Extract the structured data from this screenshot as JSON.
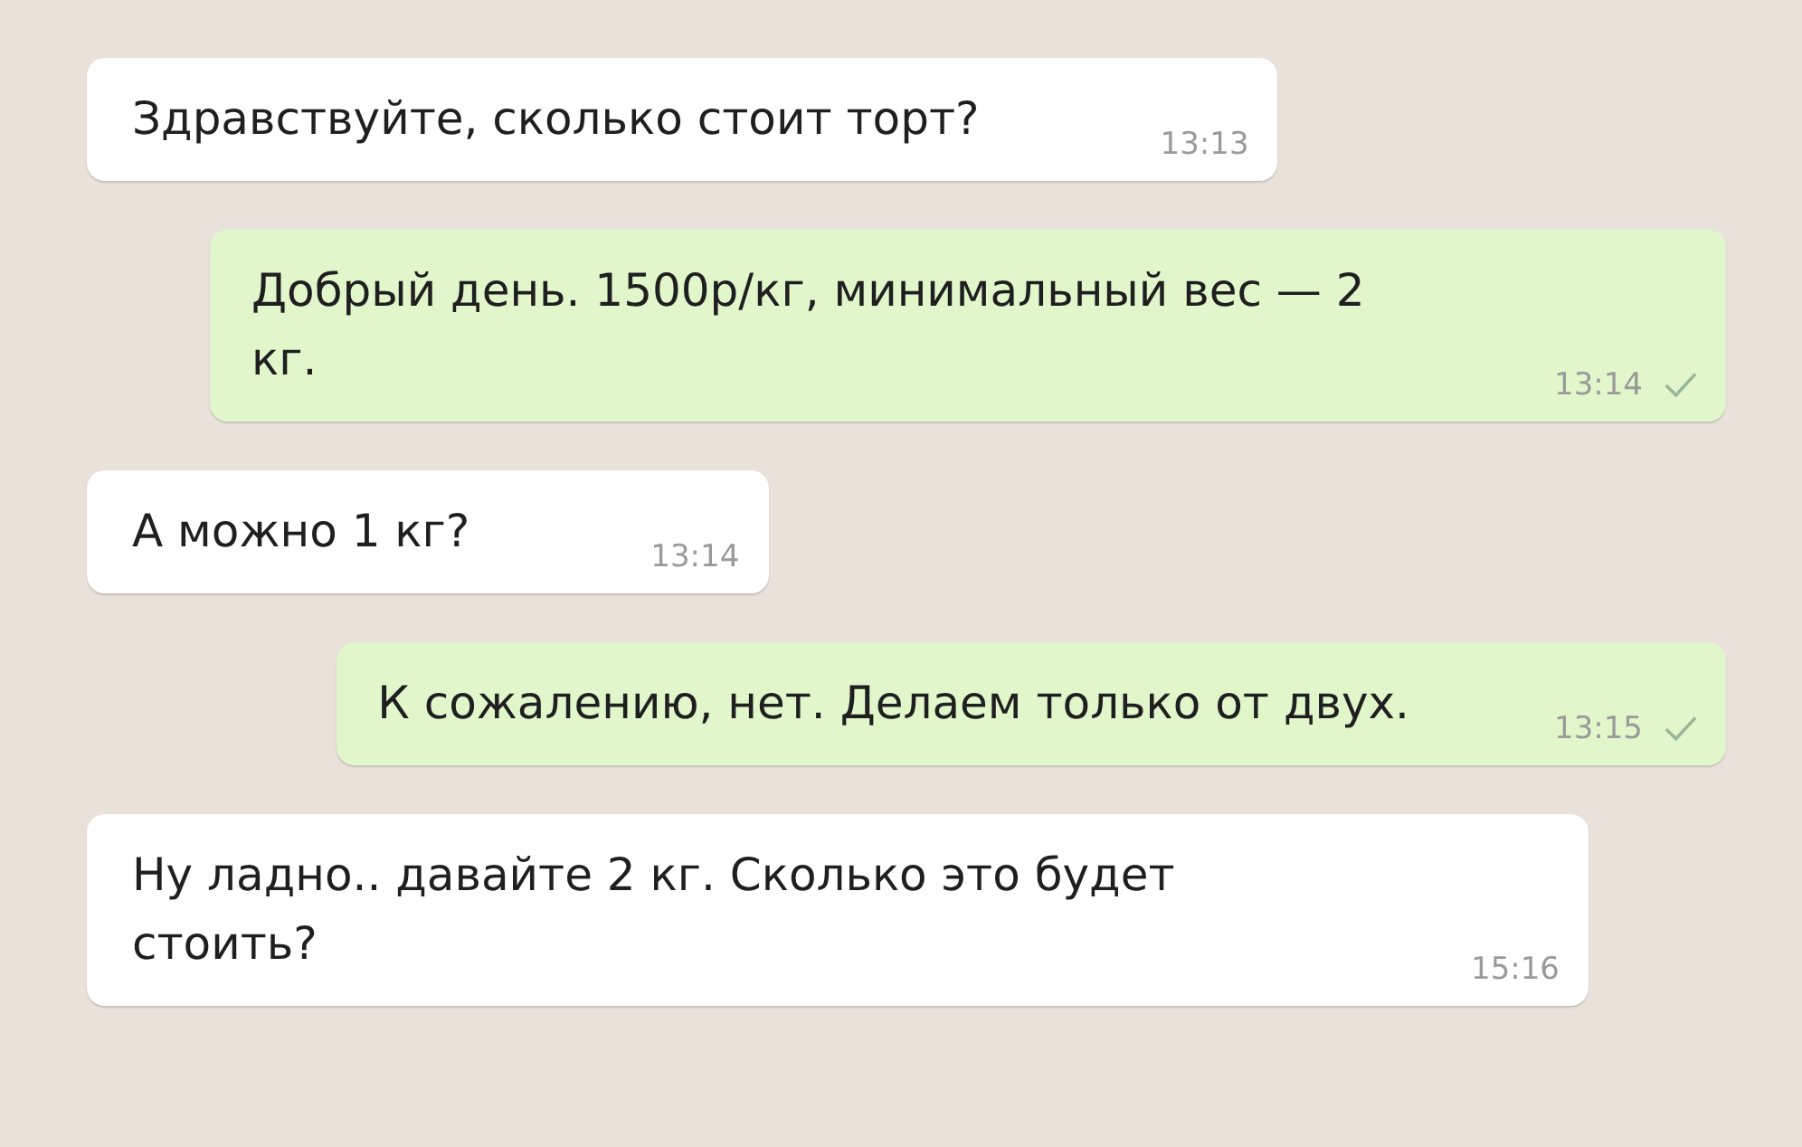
{
  "messages": [
    {
      "outgoing": false,
      "text": "Здравствуйте, сколько стоит торт?",
      "time": "13:13",
      "sent": false
    },
    {
      "outgoing": true,
      "text": "Добрый день. 1500р/кг, минимальный вес — 2 кг.",
      "time": "13:14",
      "sent": true
    },
    {
      "outgoing": false,
      "text": "А можно 1 кг?",
      "time": "13:14",
      "sent": false
    },
    {
      "outgoing": true,
      "text": "К сожалению, нет. Делаем только от двух.",
      "time": "13:15",
      "sent": true
    },
    {
      "outgoing": false,
      "text": "Ну ладно.. давайте 2 кг. Сколько это будет стоить?",
      "time": "15:16",
      "sent": false
    }
  ]
}
